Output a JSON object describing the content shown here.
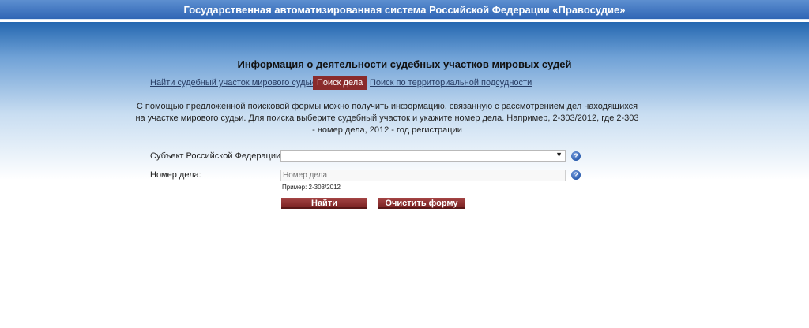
{
  "header": {
    "title": "Государственная автоматизированная система Российской Федерации «Правосудие»"
  },
  "page": {
    "title": "Информация о деятельности судебных участков мировых судей"
  },
  "nav": {
    "find_section": "Найти судебный участок мирового судьи",
    "case_search": "Поиск дела",
    "territorial_search": "Поиск по территориальной подсудности"
  },
  "description": {
    "text": "С помощью предложенной поисковой формы можно получить информацию, связанную с рассмотрением дел находящихся на участке мирового судьи. Для поиска выберите судебный участок и укажите номер дела. Например, 2-303/2012, где 2-303 - номер дела, 2012 - год регистрации"
  },
  "form": {
    "subject_label": "Субъект Российской Федерации:",
    "subject_value": "",
    "case_label": "Номер дела:",
    "case_placeholder": "Номер дела",
    "case_hint": "Пример: 2-303/2012",
    "search_button": "Найти",
    "clear_button": "Очистить форму"
  },
  "icons": {
    "help": "help-icon",
    "dropdown": "chevron-down-icon"
  },
  "colors": {
    "banner": "#2f65b5",
    "accent": "#8a2b2b"
  }
}
